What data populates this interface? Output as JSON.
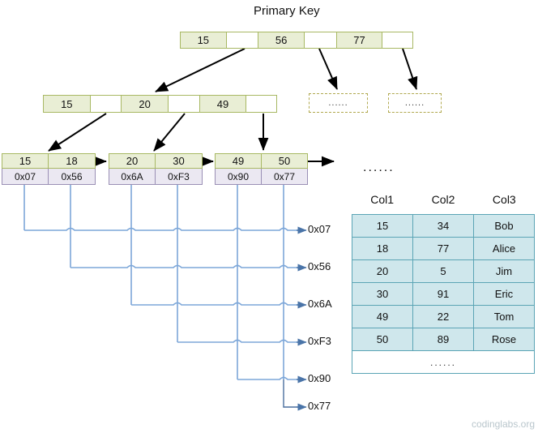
{
  "title": "Primary Key",
  "watermark": "codinglabs.org",
  "ellipsis": "......",
  "tree": {
    "root": {
      "cells": [
        {
          "label": "15",
          "empty": false
        },
        {
          "label": "",
          "empty": true
        },
        {
          "label": "56",
          "empty": false
        },
        {
          "label": "",
          "empty": true
        },
        {
          "label": "77",
          "empty": false
        },
        {
          "label": "",
          "empty": true
        }
      ]
    },
    "internal": {
      "cells": [
        {
          "label": "15",
          "empty": false
        },
        {
          "label": "",
          "empty": true
        },
        {
          "label": "20",
          "empty": false
        },
        {
          "label": "",
          "empty": true
        },
        {
          "label": "49",
          "empty": false
        },
        {
          "label": "",
          "empty": true
        }
      ]
    },
    "leaves": [
      {
        "keys": [
          "15",
          "18"
        ],
        "pointers": [
          "0x07",
          "0x56"
        ]
      },
      {
        "keys": [
          "20",
          "30"
        ],
        "pointers": [
          "0x6A",
          "0xF3"
        ]
      },
      {
        "keys": [
          "49",
          "50"
        ],
        "pointers": [
          "0x90",
          "0x77"
        ]
      }
    ],
    "dashed_boxes": [
      "......",
      "......"
    ],
    "leaf_overflow_dots": "......"
  },
  "pointer_labels": [
    "0x07",
    "0x56",
    "0x6A",
    "0xF3",
    "0x90",
    "0x77"
  ],
  "data_table": {
    "headers": [
      "Col1",
      "Col2",
      "Col3"
    ],
    "rows": [
      [
        "15",
        "34",
        "Bob"
      ],
      [
        "18",
        "77",
        "Alice"
      ],
      [
        "20",
        "5",
        "Jim"
      ],
      [
        "30",
        "91",
        "Eric"
      ],
      [
        "49",
        "22",
        "Tom"
      ],
      [
        "50",
        "89",
        "Rose"
      ]
    ],
    "last_row": "......"
  },
  "colors": {
    "node_fill": "#e9eed5",
    "node_border": "#a8b863",
    "pointer_fill": "#ebe8f2",
    "pointer_border": "#9a8fb5",
    "table_fill": "#cfe7ec",
    "table_border": "#5ba4b5",
    "connector": "#7da7d9",
    "arrow_black": "#000000"
  }
}
